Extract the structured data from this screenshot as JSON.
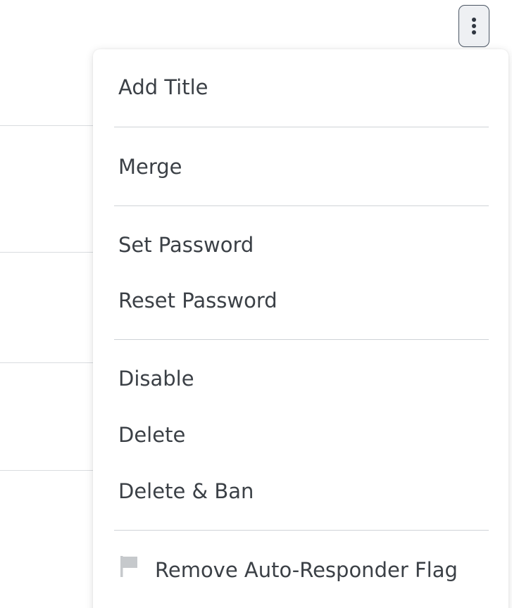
{
  "more_button": {
    "icon": "kebab-vertical-icon"
  },
  "menu": {
    "groups": [
      {
        "items": [
          {
            "label": "Add Title"
          }
        ]
      },
      {
        "items": [
          {
            "label": "Merge"
          }
        ]
      },
      {
        "items": [
          {
            "label": "Set Password"
          },
          {
            "label": "Reset Password"
          }
        ]
      },
      {
        "items": [
          {
            "label": "Disable"
          },
          {
            "label": "Delete"
          },
          {
            "label": "Delete & Ban"
          }
        ]
      },
      {
        "items": [
          {
            "label": "Remove Auto-Responder Flag",
            "icon": "flag-icon",
            "icon_color": "#c6c9cc"
          }
        ]
      }
    ]
  },
  "colors": {
    "text": "#3b4046",
    "separator": "#cfd3d7",
    "button_border": "#4a5563",
    "button_bg": "#eef0f3"
  }
}
